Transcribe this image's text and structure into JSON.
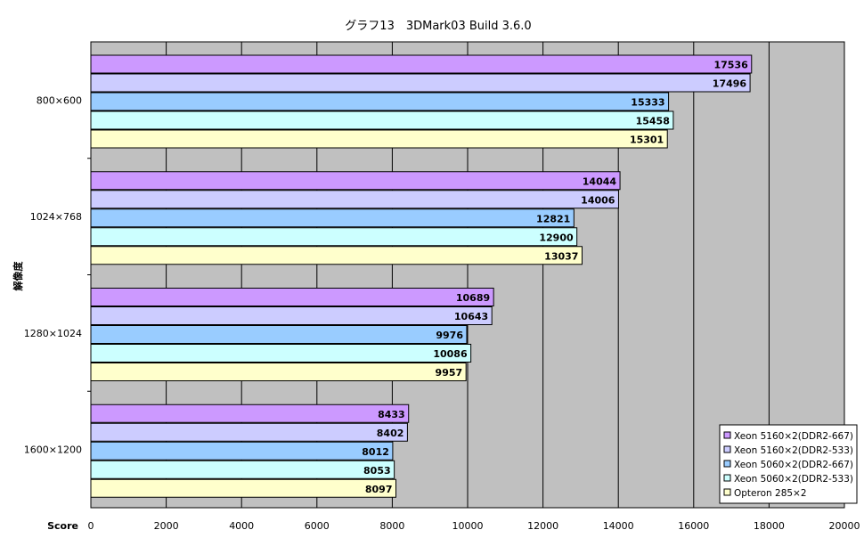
{
  "chart_data": {
    "type": "bar",
    "orientation": "horizontal",
    "title": "グラフ13　3DMark03  Build 3.6.0",
    "xlabel": "Score",
    "ylabel": "解像度",
    "xlim": [
      0,
      20000
    ],
    "xticks": [
      "0",
      "2000",
      "4000",
      "6000",
      "8000",
      "10000",
      "12000",
      "14000",
      "16000",
      "18000",
      "20000"
    ],
    "grid": true,
    "legend_position": "bottom-right",
    "categories": [
      "800×600",
      "1024×768",
      "1280×1024",
      "1600×1200"
    ],
    "series": [
      {
        "name": "Xeon 5160×2(DDR2-667)",
        "color": "#cc99ff",
        "values": [
          17536,
          14044,
          10689,
          8433
        ]
      },
      {
        "name": "Xeon 5160×2(DDR2-533)",
        "color": "#ccccff",
        "values": [
          17496,
          14006,
          10643,
          8402
        ]
      },
      {
        "name": "Xeon 5060×2(DDR2-667)",
        "color": "#99ccff",
        "values": [
          15333,
          12821,
          9976,
          8012
        ]
      },
      {
        "name": "Xeon 5060×2(DDR2-533)",
        "color": "#ccffff",
        "values": [
          15458,
          12900,
          10086,
          8053
        ]
      },
      {
        "name": "Opteron 285×2",
        "color": "#ffffcc",
        "values": [
          15301,
          13037,
          9957,
          8097
        ]
      }
    ],
    "plot_area_color": "#c0c0c0"
  }
}
